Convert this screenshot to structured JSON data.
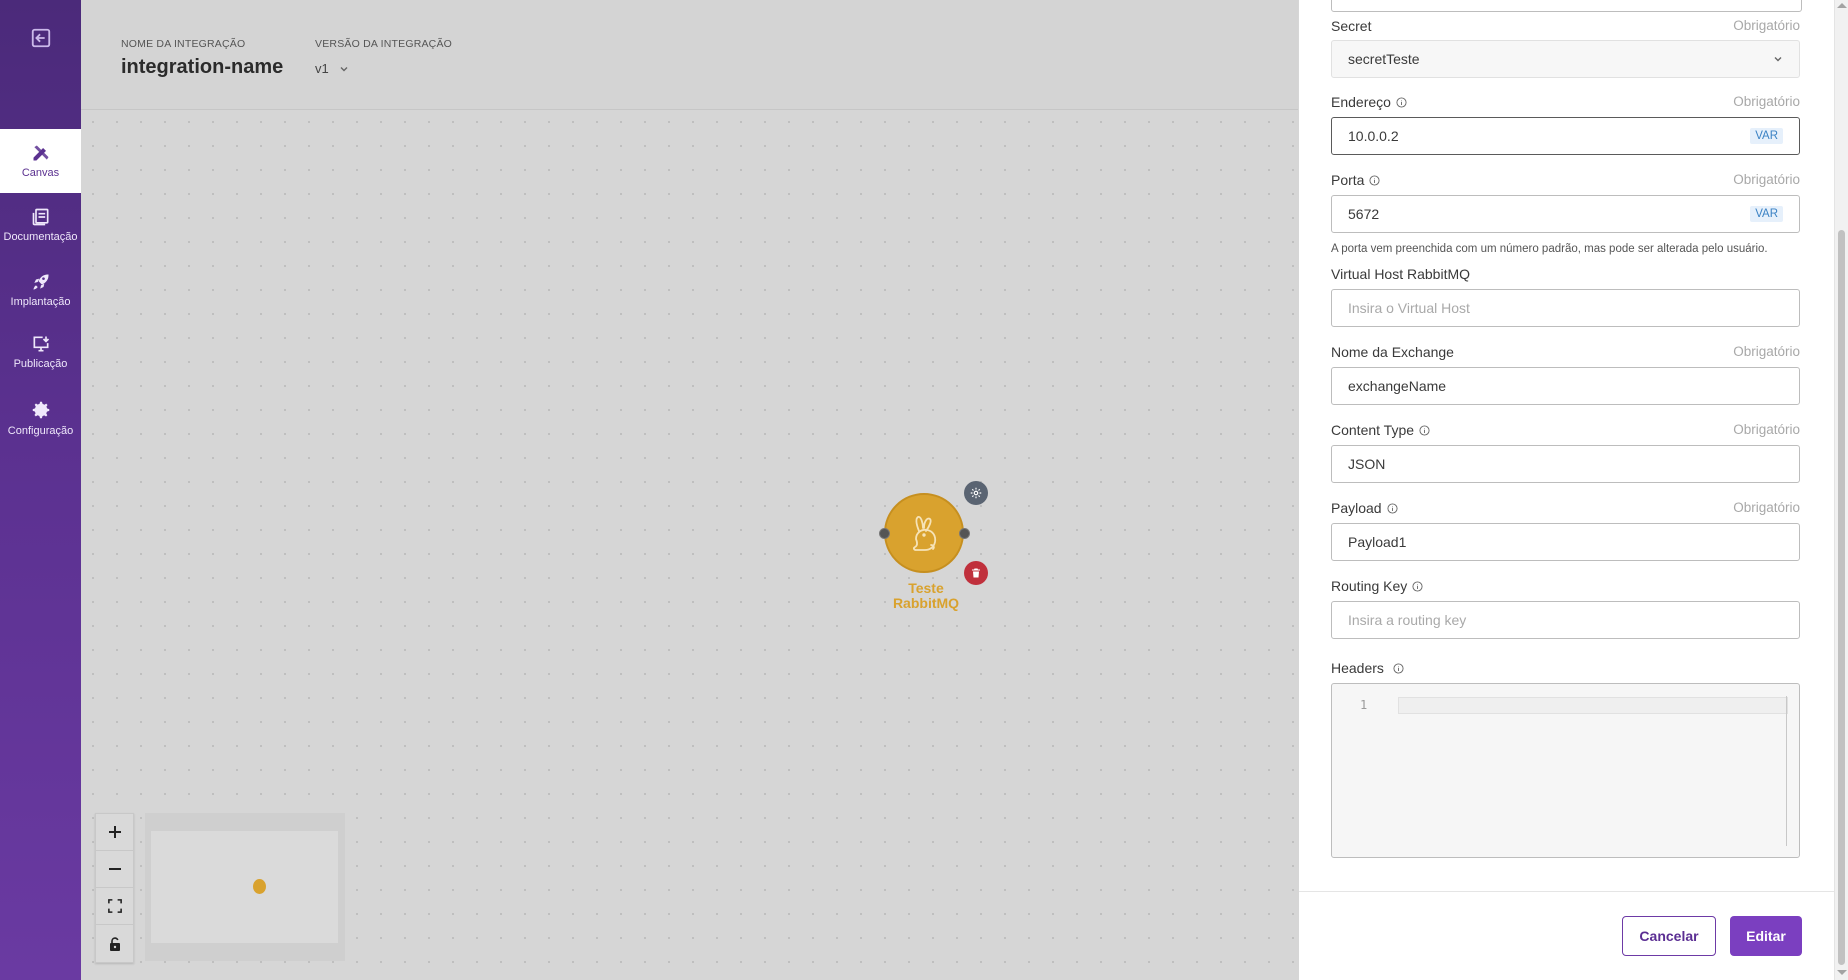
{
  "sidebar": {
    "exit_icon": "exit-icon",
    "items": [
      {
        "label": "Canvas",
        "icon": "pen-ruler-icon",
        "active": true
      },
      {
        "label": "Documentação",
        "icon": "book-icon"
      },
      {
        "label": "Implantação",
        "icon": "rocket-icon"
      },
      {
        "label": "Publicação",
        "icon": "download-monitor-icon"
      },
      {
        "label": "Configuração",
        "icon": "gear-icon"
      }
    ]
  },
  "header": {
    "name_label": "NOME DA INTEGRAÇÃO",
    "name_value": "integration-name",
    "version_label": "VERSÃO DA INTEGRAÇÃO",
    "version_value": "v1"
  },
  "canvas": {
    "node": {
      "label_line1": "Teste",
      "label_line2": "RabbitMQ",
      "icon": "rabbit-icon",
      "color": "#d9a22e"
    },
    "zoom_controls": [
      "zoom-in",
      "zoom-out",
      "fit-view",
      "lock"
    ]
  },
  "form": {
    "required_text": "Obrigatório",
    "secret": {
      "label": "Secret",
      "value": "secretTeste"
    },
    "address": {
      "label": "Endereço",
      "value": "10.0.0.2",
      "badge": "VAR"
    },
    "port": {
      "label": "Porta",
      "value": "5672",
      "badge": "VAR",
      "hint": "A porta vem preenchida com um número padrão, mas pode ser alterada pelo usuário."
    },
    "vhost": {
      "label": "Virtual Host RabbitMQ",
      "placeholder": "Insira o Virtual Host"
    },
    "exchange": {
      "label": "Nome da Exchange",
      "value": "exchangeName"
    },
    "content_type": {
      "label": "Content Type",
      "value": "JSON"
    },
    "payload": {
      "label": "Payload",
      "value": "Payload1"
    },
    "routing_key": {
      "label": "Routing Key",
      "placeholder": "Insira a routing key"
    },
    "headers": {
      "label": "Headers",
      "line_number": "1"
    }
  },
  "actions": {
    "cancel": "Cancelar",
    "edit": "Editar"
  },
  "colors": {
    "brand": "#5b3190",
    "primary_button": "#7b3fc0",
    "node": "#d9a22e",
    "delete": "#c0303c"
  }
}
